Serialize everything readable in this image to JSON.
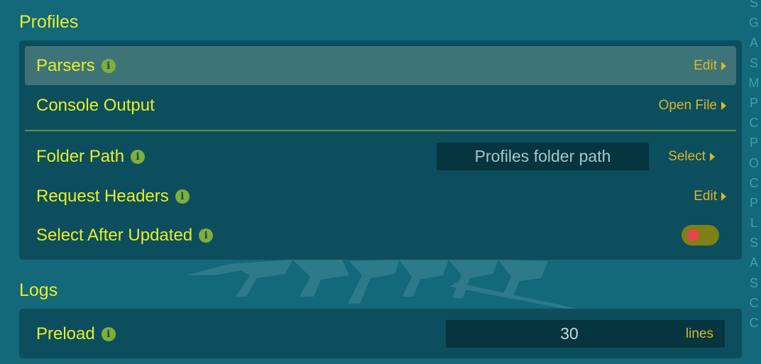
{
  "sections": {
    "profiles": {
      "title": "Profiles",
      "parsers": {
        "label": "Parsers",
        "action": "Edit"
      },
      "console_output": {
        "label": "Console Output",
        "action": "Open File"
      },
      "folder_path": {
        "label": "Folder Path",
        "placeholder": "Profiles folder path",
        "action": "Select"
      },
      "request_headers": {
        "label": "Request Headers",
        "action": "Edit"
      },
      "select_after_updated": {
        "label": "Select After Updated",
        "enabled": false
      }
    },
    "logs": {
      "title": "Logs",
      "preload": {
        "label": "Preload",
        "value": "30",
        "unit": "lines"
      }
    }
  },
  "info_glyph": "i",
  "watermark": "CYBERPUNK",
  "index_letters": [
    "S",
    "G",
    "A",
    "S",
    "M",
    "P",
    "C",
    "P",
    "O",
    "C",
    "P",
    "L",
    "S",
    "A",
    "S",
    "C",
    "C"
  ],
  "colors": {
    "background": "#136879",
    "card": "#0c4e5d",
    "accent_yellow": "#e9ee2a",
    "action_gold": "#d4b92a",
    "info_green": "#7fae3b",
    "toggle_off_track": "#7e7f16",
    "toggle_knob": "#e0464c",
    "index_letter": "#39a4a8"
  },
  "icons": [
    "info-icon",
    "chevron-right-icon",
    "cyberpunk-logo"
  ]
}
